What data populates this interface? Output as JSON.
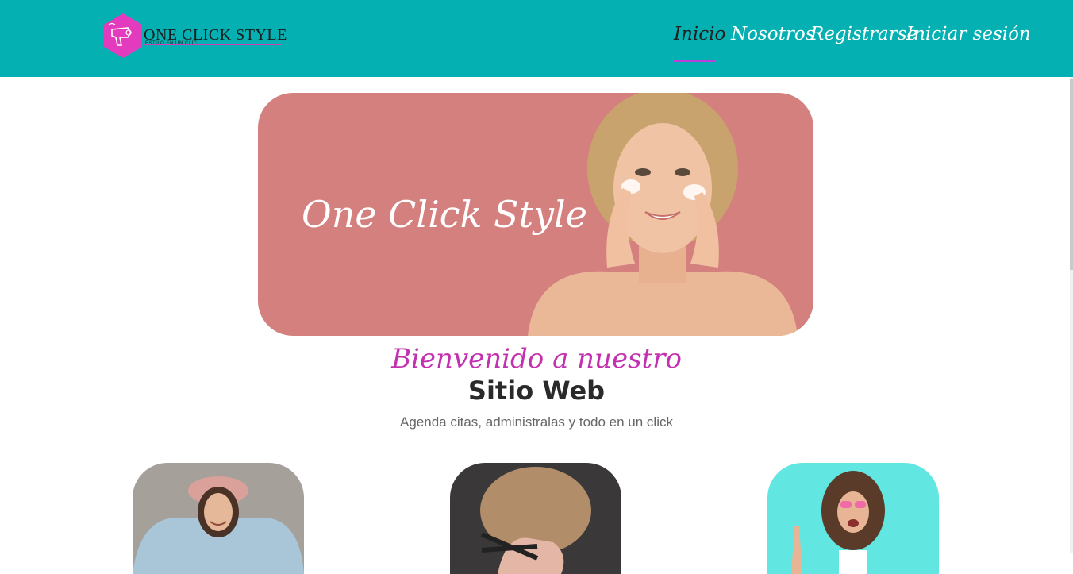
{
  "header": {
    "bg_color": "#05b0b2",
    "logo": {
      "title": "ONE CLICK STYLE",
      "tagline": "ESTILO EN UN CLIC",
      "icon": "hair-dryer-icon",
      "accent": "#e23bbd"
    },
    "nav": [
      {
        "label": "Inicio",
        "active": true
      },
      {
        "label": "Nosotros",
        "active": false
      },
      {
        "label": "Registrarse",
        "active": false
      },
      {
        "label": "Iniciar sesión",
        "active": false
      }
    ]
  },
  "hero": {
    "title": "One Click Style",
    "bg_color": "#d4807e"
  },
  "welcome": {
    "line1": "Bienvenido a nuestro",
    "line2": "Sitio Web",
    "subtitle": "Agenda citas, administralas y todo en un click"
  },
  "cards": [
    {
      "image": "woman-with-hat-photo"
    },
    {
      "image": "haircut-scissors-photo"
    },
    {
      "image": "curly-hair-woman-photo"
    }
  ]
}
